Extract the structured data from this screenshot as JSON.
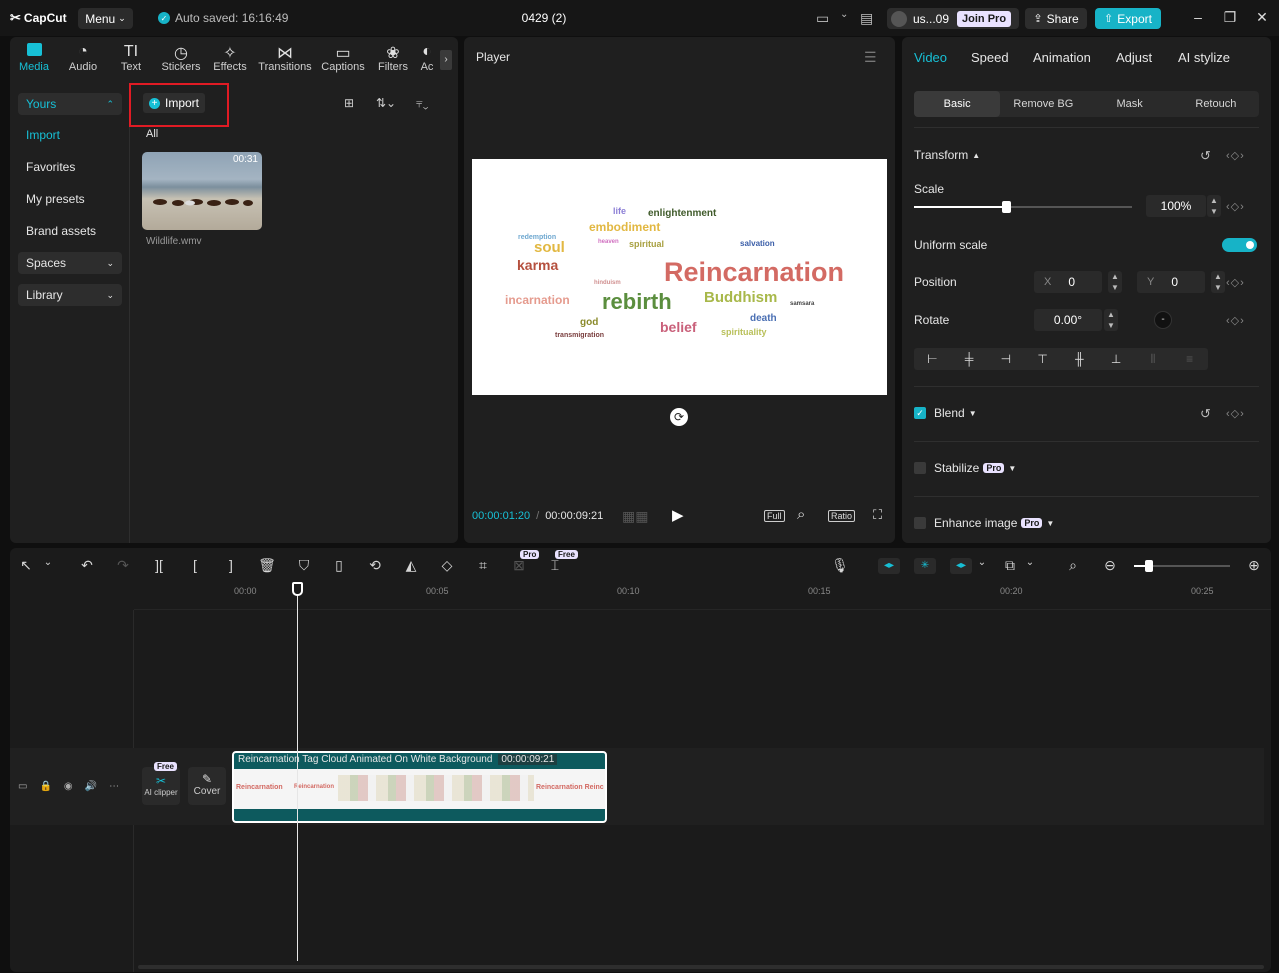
{
  "app": {
    "logo": "CapCut",
    "menu_label": "Menu",
    "autosave": "Auto saved: 16:16:49",
    "project_title": "0429 (2)",
    "user_name": "us...09",
    "join_pro": "Join Pro",
    "share": "Share",
    "export": "Export"
  },
  "tool_tabs": [
    "Media",
    "Audio",
    "Text",
    "Stickers",
    "Effects",
    "Transitions",
    "Captions",
    "Filters",
    "Ac"
  ],
  "sidebar": {
    "yours": "Yours",
    "import": "Import",
    "favorites": "Favorites",
    "my_presets": "My presets",
    "brand_assets": "Brand assets",
    "spaces": "Spaces",
    "library": "Library"
  },
  "media": {
    "import_button": "Import",
    "filter_all": "All",
    "item_name": "Wildlife.wmv",
    "item_duration": "00:31"
  },
  "player": {
    "title": "Player",
    "current_time": "00:00:01:20",
    "total_time": "00:00:09:21",
    "full_label": "Full",
    "ratio_label": "Ratio",
    "words": [
      "Reincarnation",
      "rebirth",
      "Buddhism",
      "karma",
      "soul",
      "embodiment",
      "enlightenment",
      "incarnation",
      "belief",
      "death",
      "god",
      "spirituality",
      "spiritual",
      "salvation",
      "life",
      "transmigration",
      "redemption",
      "heaven",
      "hinduism",
      "samsara"
    ]
  },
  "inspector": {
    "tabs": [
      "Video",
      "Speed",
      "Animation",
      "Adjust",
      "AI stylize"
    ],
    "subtabs": [
      "Basic",
      "Remove BG",
      "Mask",
      "Retouch"
    ],
    "transform": "Transform",
    "scale_label": "Scale",
    "scale_value": "100%",
    "scale_fraction": 0.42,
    "uniform_scale": "Uniform scale",
    "position_label": "Position",
    "pos_x_label": "X",
    "pos_x": "0",
    "pos_y_label": "Y",
    "pos_y": "0",
    "rotate_label": "Rotate",
    "rotate_value": "0.00°",
    "blend": "Blend",
    "stabilize": "Stabilize",
    "enhance_image": "Enhance image",
    "pro_badge": "Pro"
  },
  "timeline": {
    "ruler": [
      "00:00",
      "00:05",
      "00:10",
      "00:15",
      "00:20",
      "00:25"
    ],
    "pro_badge": "Pro",
    "free_badge": "Free",
    "ai_clipper": "AI clipper",
    "ai_free_badge": "Free",
    "cover": "Cover",
    "clip_title": "Reincarnation Tag Cloud Animated On White Background",
    "clip_duration": "00:00:09:21",
    "clip_thumb_words": [
      "Reincarnation",
      "Reincarnation",
      "Reincarnation Reinc"
    ]
  },
  "colors": {
    "accent": "#17c0d6",
    "panel": "#1f1f1f",
    "highlight_box": "#e01b24"
  }
}
